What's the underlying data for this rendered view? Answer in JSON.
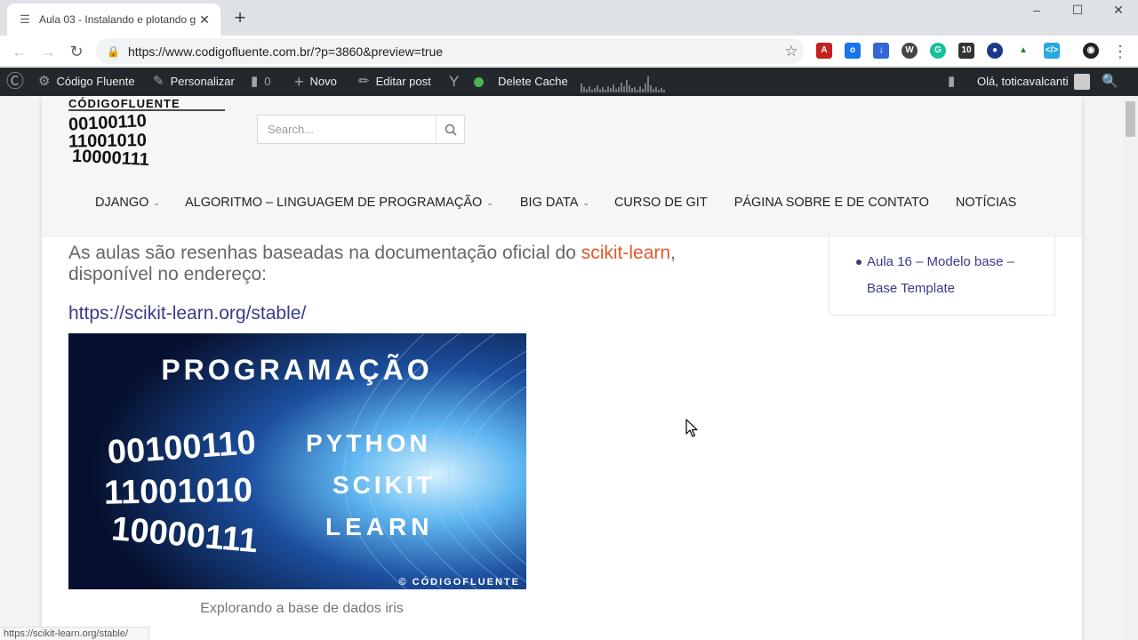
{
  "browser": {
    "tab_title": "Aula 03 - Instalando e plotando g",
    "url": "https://www.codigofluente.com.br/?p=3860&preview=true"
  },
  "extensions": [
    "pdf-icon",
    "outlook-icon",
    "download-icon",
    "wordpress-icon",
    "grammarly-icon",
    "10",
    "browser-icon",
    "chart-icon",
    "code-icon",
    "globe-icon"
  ],
  "adminbar": {
    "site_name": "Código Fluente",
    "customize": "Personalizar",
    "comments_count": "0",
    "new": "Novo",
    "edit_post": "Editar post",
    "delete_cache": "Delete Cache",
    "greeting": "Olá, toticavalcanti",
    "status_color": "#46b450"
  },
  "site": {
    "logo": {
      "brand": "CÓDIGOFLUENTE",
      "binary_lines": [
        "00100110",
        "11001010",
        "10000111"
      ]
    },
    "search_placeholder": "Search...",
    "nav": [
      {
        "label": "DJANGO",
        "dropdown": true
      },
      {
        "label": "ALGORITMO – LINGUAGEM DE PROGRAMAÇÃO",
        "dropdown": true
      },
      {
        "label": "BIG DATA",
        "dropdown": true
      },
      {
        "label": "CURSO DE GIT",
        "dropdown": false
      },
      {
        "label": "PÁGINA SOBRE E DE CONTATO",
        "dropdown": false
      },
      {
        "label": "NOTÍCIAS",
        "dropdown": false
      }
    ]
  },
  "content": {
    "intro_prefix": "As aulas são resenhas baseadas na documentação oficial do ",
    "intro_link": "scikit-learn",
    "intro_suffix": ", disponível no endereço:",
    "url_link": "https://scikit-learn.org/stable/",
    "banner": {
      "title": "PROGRAMAÇÃO",
      "binary_lines": [
        "00100110",
        "11001010",
        "10000111"
      ],
      "words": [
        "PYTHON",
        "SCIKIT",
        "LEARN"
      ],
      "credit": "© CÓDIGOFLUENTE"
    },
    "caption": "Explorando a base de dados iris"
  },
  "sidebar": {
    "link_line1": "Aula 16 – Modelo base –",
    "link_line2": "Base Template"
  },
  "status_url": "https://scikit-learn.org/stable/"
}
